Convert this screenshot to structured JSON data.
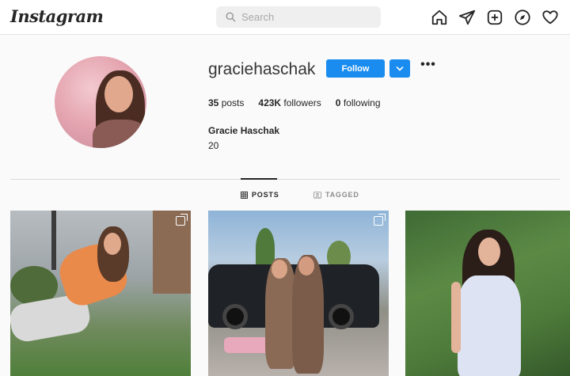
{
  "header": {
    "logo": "Instagram",
    "search_placeholder": "Search",
    "icons": [
      "home-icon",
      "direct-icon",
      "new-post-icon",
      "explore-icon",
      "activity-icon"
    ]
  },
  "profile": {
    "username": "graciehaschak",
    "follow_label": "Follow",
    "stats": {
      "posts_count": "35",
      "posts_label": "posts",
      "followers_count": "423K",
      "followers_label": "followers",
      "following_count": "0",
      "following_label": "following"
    },
    "full_name": "Gracie Haschak",
    "bio": "20"
  },
  "tabs": [
    {
      "label": "POSTS",
      "active": true
    },
    {
      "label": "TAGGED",
      "active": false
    }
  ],
  "posts": [
    {
      "multi": true
    },
    {
      "multi": true
    },
    {
      "multi": false
    }
  ],
  "colors": {
    "accent": "#1a8cf0",
    "text": "#262626",
    "muted": "#8e8e8e",
    "background": "#fafafa"
  }
}
